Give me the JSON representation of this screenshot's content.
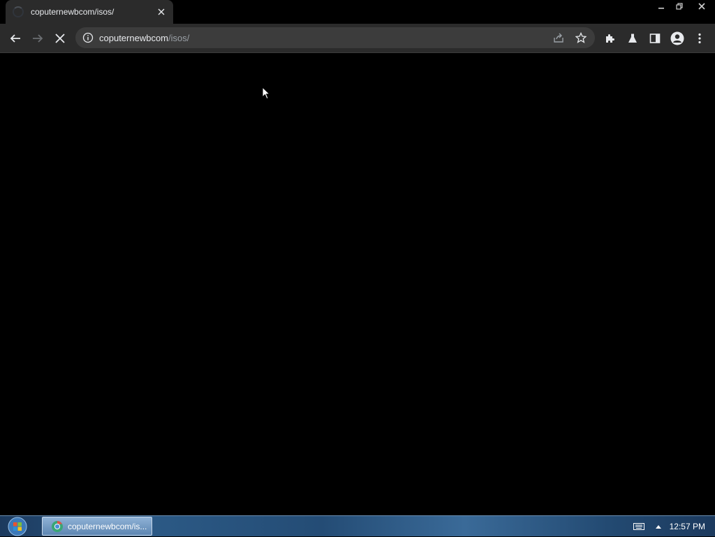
{
  "browser": {
    "tab": {
      "title": "coputernewbcom/isos/"
    },
    "address_bar": {
      "host": "coputernewbcom",
      "path": "/isos/"
    },
    "loading": true
  },
  "taskbar": {
    "task_button_label": "coputernewbcom/is...",
    "clock": "12:57 PM"
  },
  "colors": {
    "page_background": "#000000",
    "toolbar_background": "#2b2b2b",
    "omnibox_background": "#3c3c3c",
    "text": "#e8eaed"
  }
}
